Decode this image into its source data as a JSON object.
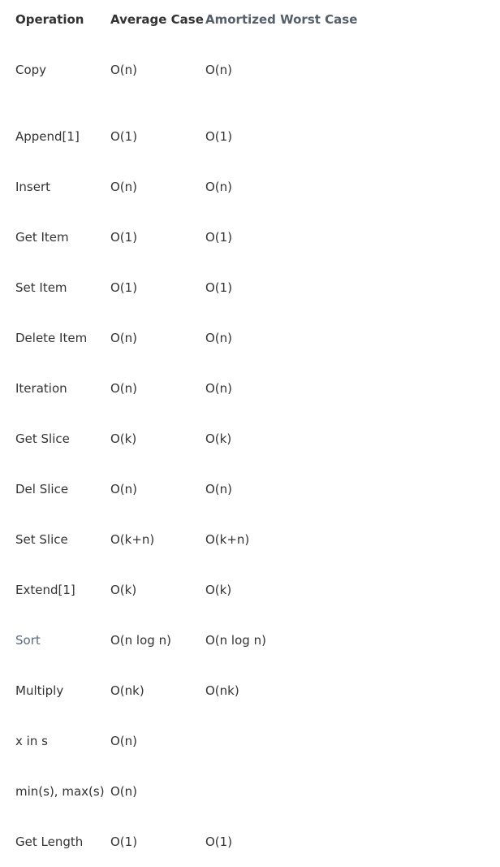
{
  "table": {
    "headers": {
      "operation": "Operation",
      "average": "Average Case",
      "worst": "Amortized Worst Case"
    },
    "rows": [
      {
        "op": "Copy",
        "avg": "O(n)",
        "worst": "O(n)"
      },
      {
        "op": "Append[1]",
        "avg": "O(1)",
        "worst": "O(1)"
      },
      {
        "op": "Insert",
        "avg": "O(n)",
        "worst": "O(n)"
      },
      {
        "op": "Get Item",
        "avg": "O(1)",
        "worst": "O(1)"
      },
      {
        "op": "Set Item",
        "avg": "O(1)",
        "worst": "O(1)"
      },
      {
        "op": "Delete Item",
        "avg": "O(n)",
        "worst": "O(n)"
      },
      {
        "op": "Iteration",
        "avg": "O(n)",
        "worst": "O(n)"
      },
      {
        "op": "Get Slice",
        "avg": "O(k)",
        "worst": "O(k)"
      },
      {
        "op": "Del Slice",
        "avg": "O(n)",
        "worst": "O(n)"
      },
      {
        "op": "Set Slice",
        "avg": "O(k+n)",
        "worst": "O(k+n)"
      },
      {
        "op": "Extend[1]",
        "avg": "O(k)",
        "worst": "O(k)"
      },
      {
        "op": "Sort",
        "avg": "O(n log n)",
        "worst": "O(n log n)"
      },
      {
        "op": "Multiply",
        "avg": "O(nk)",
        "worst": "O(nk)"
      },
      {
        "op": "x in s",
        "avg": "O(n)",
        "worst": ""
      },
      {
        "op": "min(s), max(s)",
        "avg": "O(n)",
        "worst": ""
      },
      {
        "op": "Get Length",
        "avg": "O(1)",
        "worst": "O(1)"
      }
    ]
  }
}
